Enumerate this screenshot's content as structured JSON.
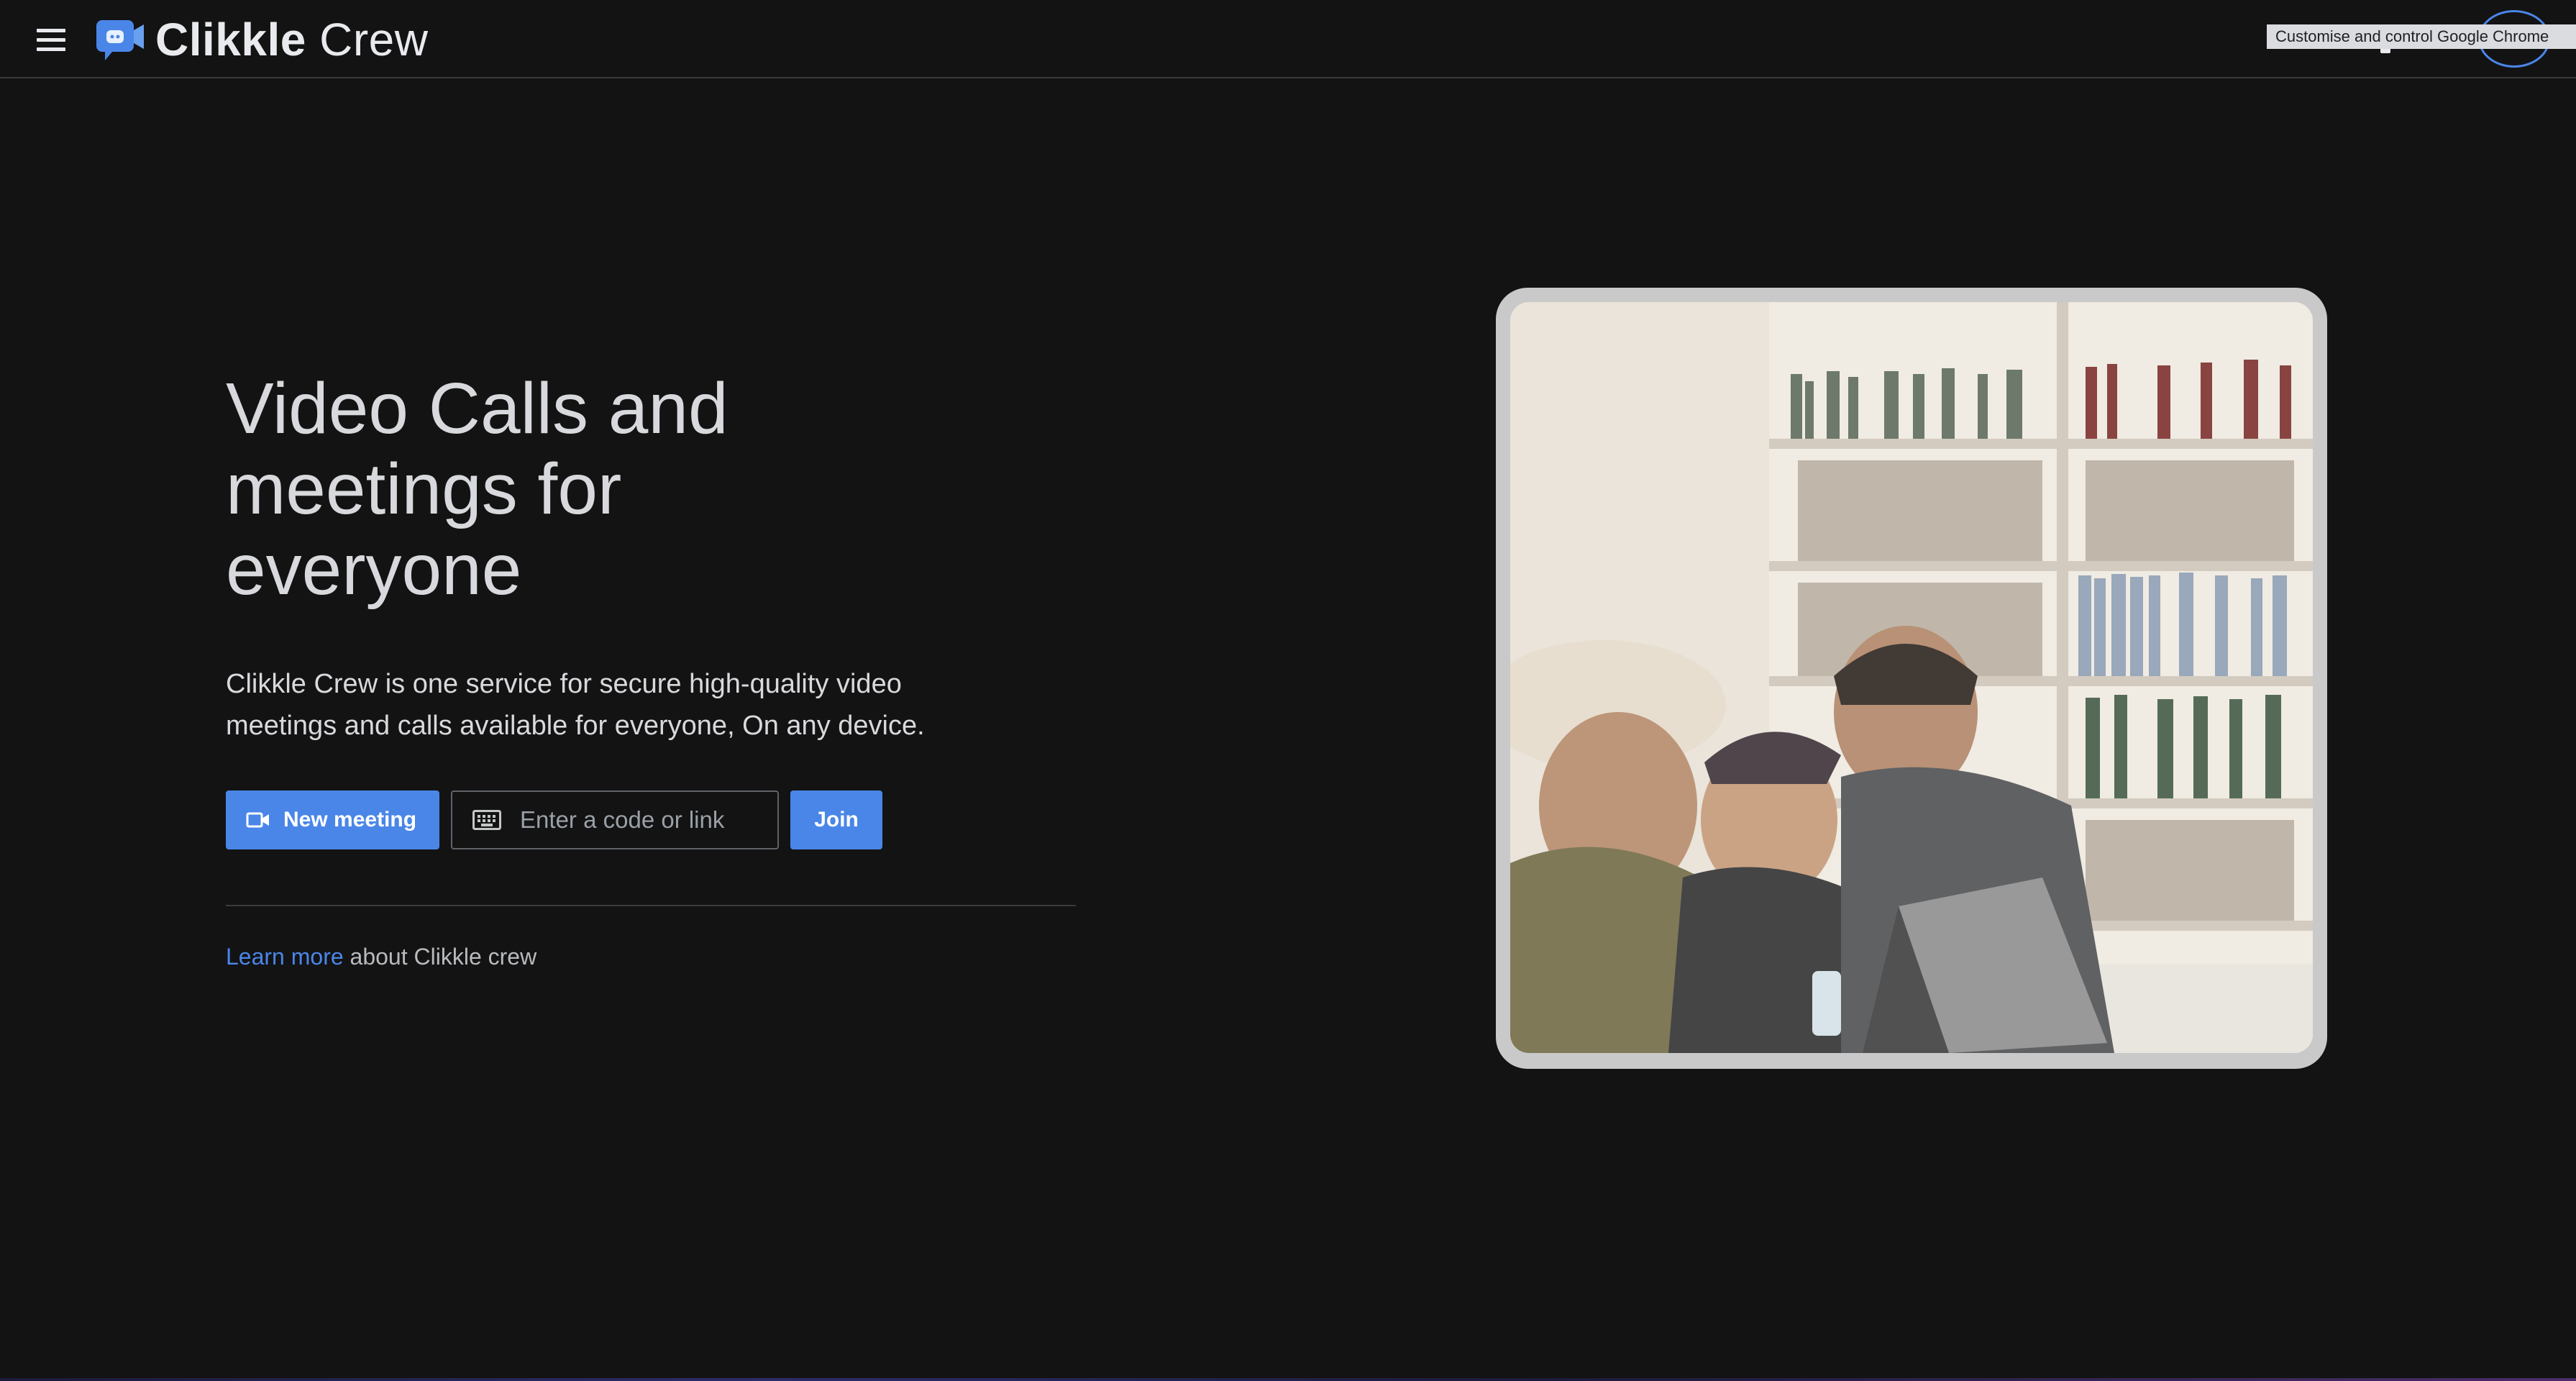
{
  "header": {
    "brand_bold": "Clikkle",
    "brand_light": "Crew",
    "menu_icon": "hamburger-menu-icon",
    "logo_icon": "chat-camera-logo-icon"
  },
  "browser": {
    "tooltip": "Customise and control Google Chrome"
  },
  "hero": {
    "title": "Video Calls and meetings for everyone",
    "subtitle": "Clikkle Crew is one service for secure high-quality video meetings and calls available for everyone, On any device."
  },
  "actions": {
    "new_meeting_label": "New meeting",
    "code_placeholder": "Enter a code or link",
    "join_label": "Join"
  },
  "footer_link": {
    "link_text": "Learn more",
    "rest_text": " about Clikkle crew"
  },
  "colors": {
    "accent": "#4a86e8",
    "background": "#131314",
    "text": "#d8d9dc"
  }
}
